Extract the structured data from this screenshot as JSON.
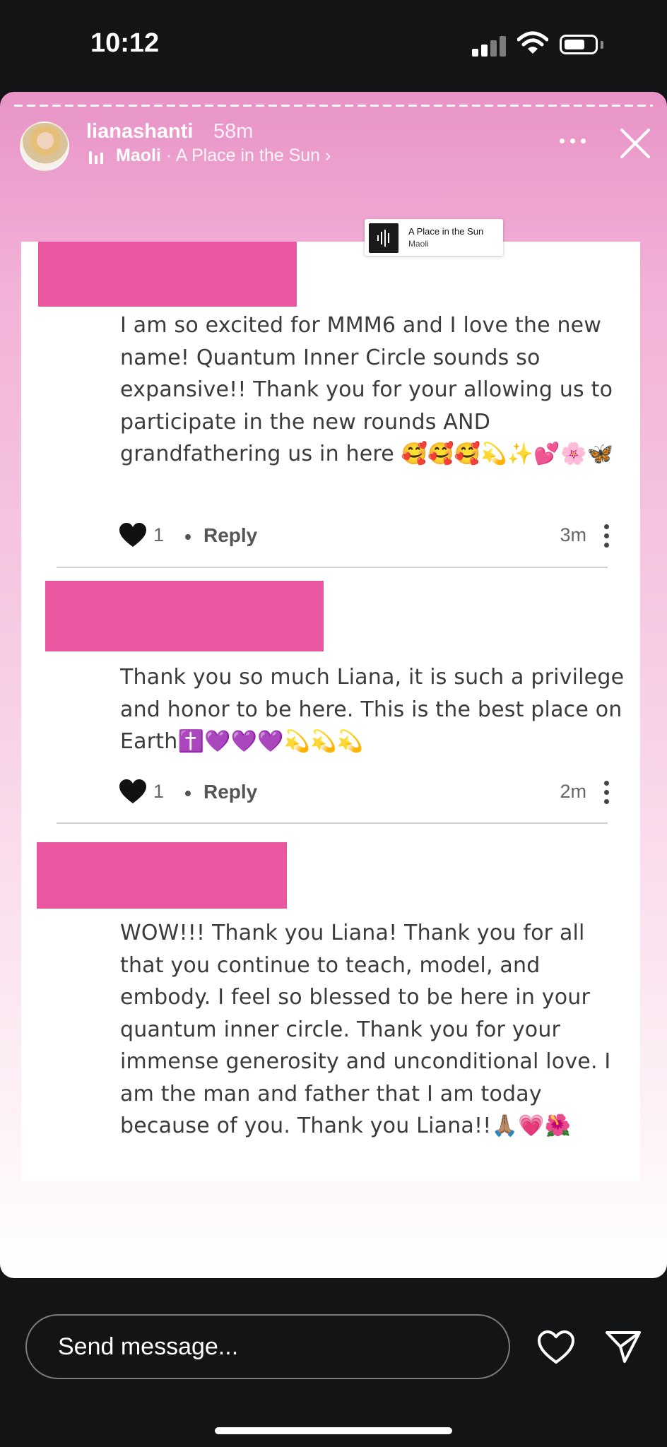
{
  "status_bar": {
    "time": "10:12"
  },
  "story": {
    "username": "lianashanti",
    "posted_ago": "58m",
    "music": {
      "artist": "Maoli",
      "separator": " · ",
      "song": "A Place in the Sun ›"
    }
  },
  "music_sticker": {
    "title": "A Place in the Sun",
    "artist": "Maoli"
  },
  "comments": [
    {
      "text": "I am so excited for MMM6 and I love the new name! Quantum Inner Circle sounds so expansive!! Thank you for your allowing us to participate in the new rounds AND grandfathering us in here 🥰🥰🥰💫✨💕🌸🦋",
      "likes": "1",
      "reply_label": "Reply",
      "time": "3m"
    },
    {
      "text": "Thank you so much Liana, it is such a privilege and honor to be here. This is the best place on Earth✝️💜💜💜💫💫💫",
      "likes": "1",
      "reply_label": "Reply",
      "time": "2m"
    },
    {
      "text": "WOW!!! Thank you Liana! Thank you for all that you continue to teach, model, and embody. I feel so blessed to be here in your quantum inner circle. Thank you for your immense generosity and unconditional love. I am the man and father that I am today because of you. Thank you Liana!!🙏🏽💗🌺"
    }
  ],
  "message_bar": {
    "placeholder": "Send message..."
  },
  "colors": {
    "redaction": "#e8579f",
    "story_gradient_top": "#e893c6",
    "background": "#121416"
  },
  "icons": [
    "signal-icon",
    "wifi-icon",
    "battery-icon",
    "music-bars-icon",
    "more-icon",
    "close-icon",
    "heart-icon",
    "kebab-icon",
    "share-icon"
  ]
}
